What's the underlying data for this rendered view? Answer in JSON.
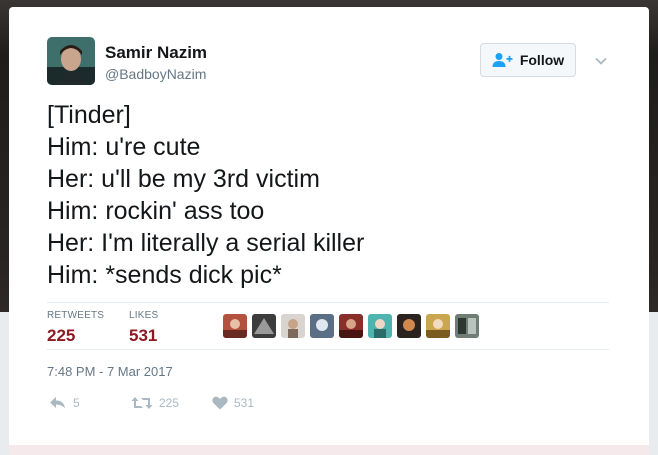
{
  "user": {
    "display_name": "Samir Nazim",
    "handle": "@BadboyNazim",
    "avatar_icon": "profile-photo"
  },
  "follow_button": {
    "label": "Follow",
    "icon": "add-user-icon"
  },
  "menu": {
    "icon": "chevron-down-icon"
  },
  "tweet": {
    "lines": [
      "[Tinder]",
      "Him: u're cute",
      "Her: u'll be my 3rd victim",
      "Him: rockin' ass too",
      "Her: I'm literally a serial killer",
      "Him: *sends dick pic*"
    ]
  },
  "stats": {
    "retweets_label": "RETWEETS",
    "retweets_count": "225",
    "likes_label": "LIKES",
    "likes_count": "531"
  },
  "likers": {
    "count_shown": 9
  },
  "timestamp": "7:48 PM - 7 Mar 2017",
  "actions": {
    "reply_count": "5",
    "retweet_count": "225",
    "like_count": "531"
  },
  "colors": {
    "accent": "#8b1a23",
    "text": "#14171a",
    "muted": "#657786",
    "icon": "#aab8c2",
    "follow_icon": "#1da1f2"
  }
}
